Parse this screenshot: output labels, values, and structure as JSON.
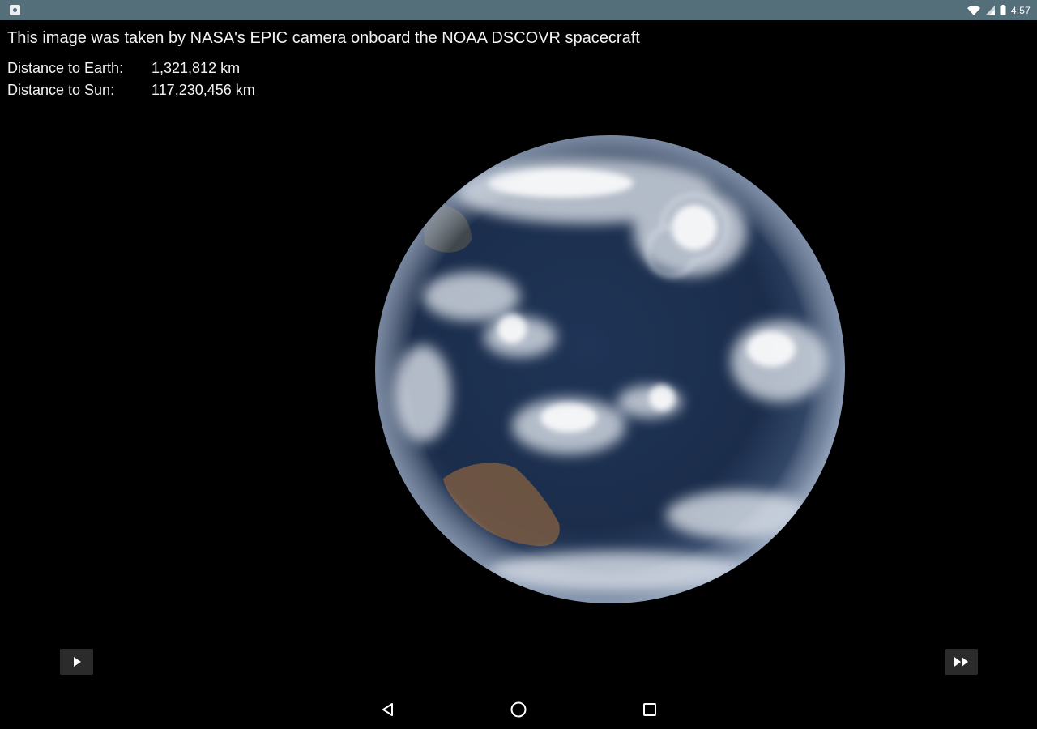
{
  "status_bar": {
    "time": "4:57",
    "icons": [
      "app-notification-icon",
      "wifi-icon",
      "signal-icon",
      "battery-icon"
    ]
  },
  "info": {
    "caption": "This image was taken by NASA's EPIC camera onboard the NOAA DSCOVR spacecraft",
    "earth_label": "Distance to Earth:",
    "earth_value": "1,321,812 km",
    "sun_label": "Distance to Sun:",
    "sun_value": "117,230,456 km"
  },
  "controls": {
    "play_icon": "play-icon",
    "fast_forward_icon": "fast-forward-icon"
  },
  "nav_bar": {
    "icons": [
      "back-icon",
      "home-icon",
      "recents-icon"
    ]
  },
  "colors": {
    "status_bar": "#546e7a",
    "background": "#000000",
    "text": "#f2f2f2",
    "button": "#2b2b2b"
  }
}
